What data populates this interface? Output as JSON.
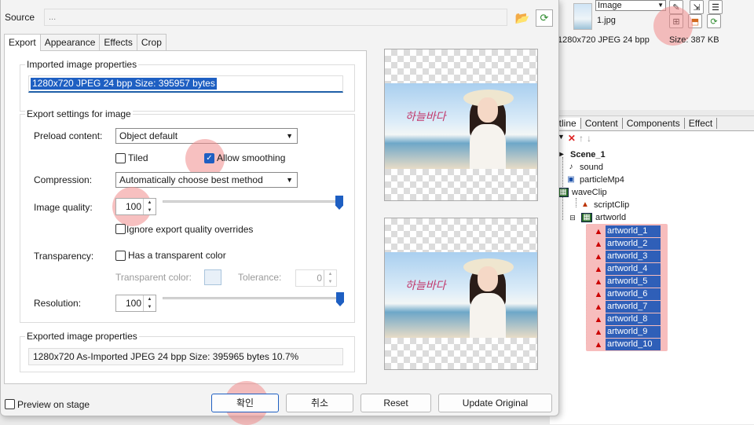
{
  "background_app": {
    "type_select": "Image",
    "filename": "1.jpg",
    "info": "1280x720 JPEG 24 bpp",
    "size": "Size: 387 KB",
    "outline_tabs": [
      "utline",
      "Content",
      "Components",
      "Effect"
    ],
    "tree": {
      "scene": "Scene_1",
      "items": [
        "sound",
        "particleMp4",
        "waveClip",
        "scriptClip",
        "artworld"
      ],
      "selected": [
        "artworld_1",
        "artworld_2",
        "artworld_3",
        "artworld_4",
        "artworld_5",
        "artworld_6",
        "artworld_7",
        "artworld_8",
        "artworld_9",
        "artworld_10"
      ]
    }
  },
  "dialog": {
    "source_label": "Source",
    "source_value": "...",
    "tabs": [
      "Export",
      "Appearance",
      "Effects",
      "Crop"
    ],
    "imported_group": "Imported image properties",
    "imported_value": "1280x720 JPEG 24 bpp Size: 395957 bytes",
    "export_group": "Export settings for image",
    "preload_label": "Preload content:",
    "preload_value": "Object default",
    "tiled_label": "Tiled",
    "smoothing_label": "Allow smoothing",
    "compression_label": "Compression:",
    "compression_value": "Automatically choose best method",
    "quality_label": "Image quality:",
    "quality_value": "100",
    "quality_fraction": 1.0,
    "ignore_label": "Ignore export quality overrides",
    "transparency_label": "Transparency:",
    "transparent_color_label": "Has a transparent color",
    "transparent_color_field": "Transparent color:",
    "tolerance_label": "Tolerance:",
    "tolerance_value": "0",
    "resolution_label": "Resolution:",
    "resolution_value": "100",
    "exported_group": "Exported image properties",
    "exported_value": "1280x720 As-Imported JPEG 24 bpp Size: 395965 bytes 10.7%",
    "preview_logo": "하늘바다",
    "preview_on_stage": "Preview on stage",
    "ok": "확인",
    "cancel": "취소",
    "reset": "Reset",
    "update": "Update Original"
  },
  "colors": {
    "accent": "#1e5fc2",
    "highlight": "#f08c8c"
  }
}
